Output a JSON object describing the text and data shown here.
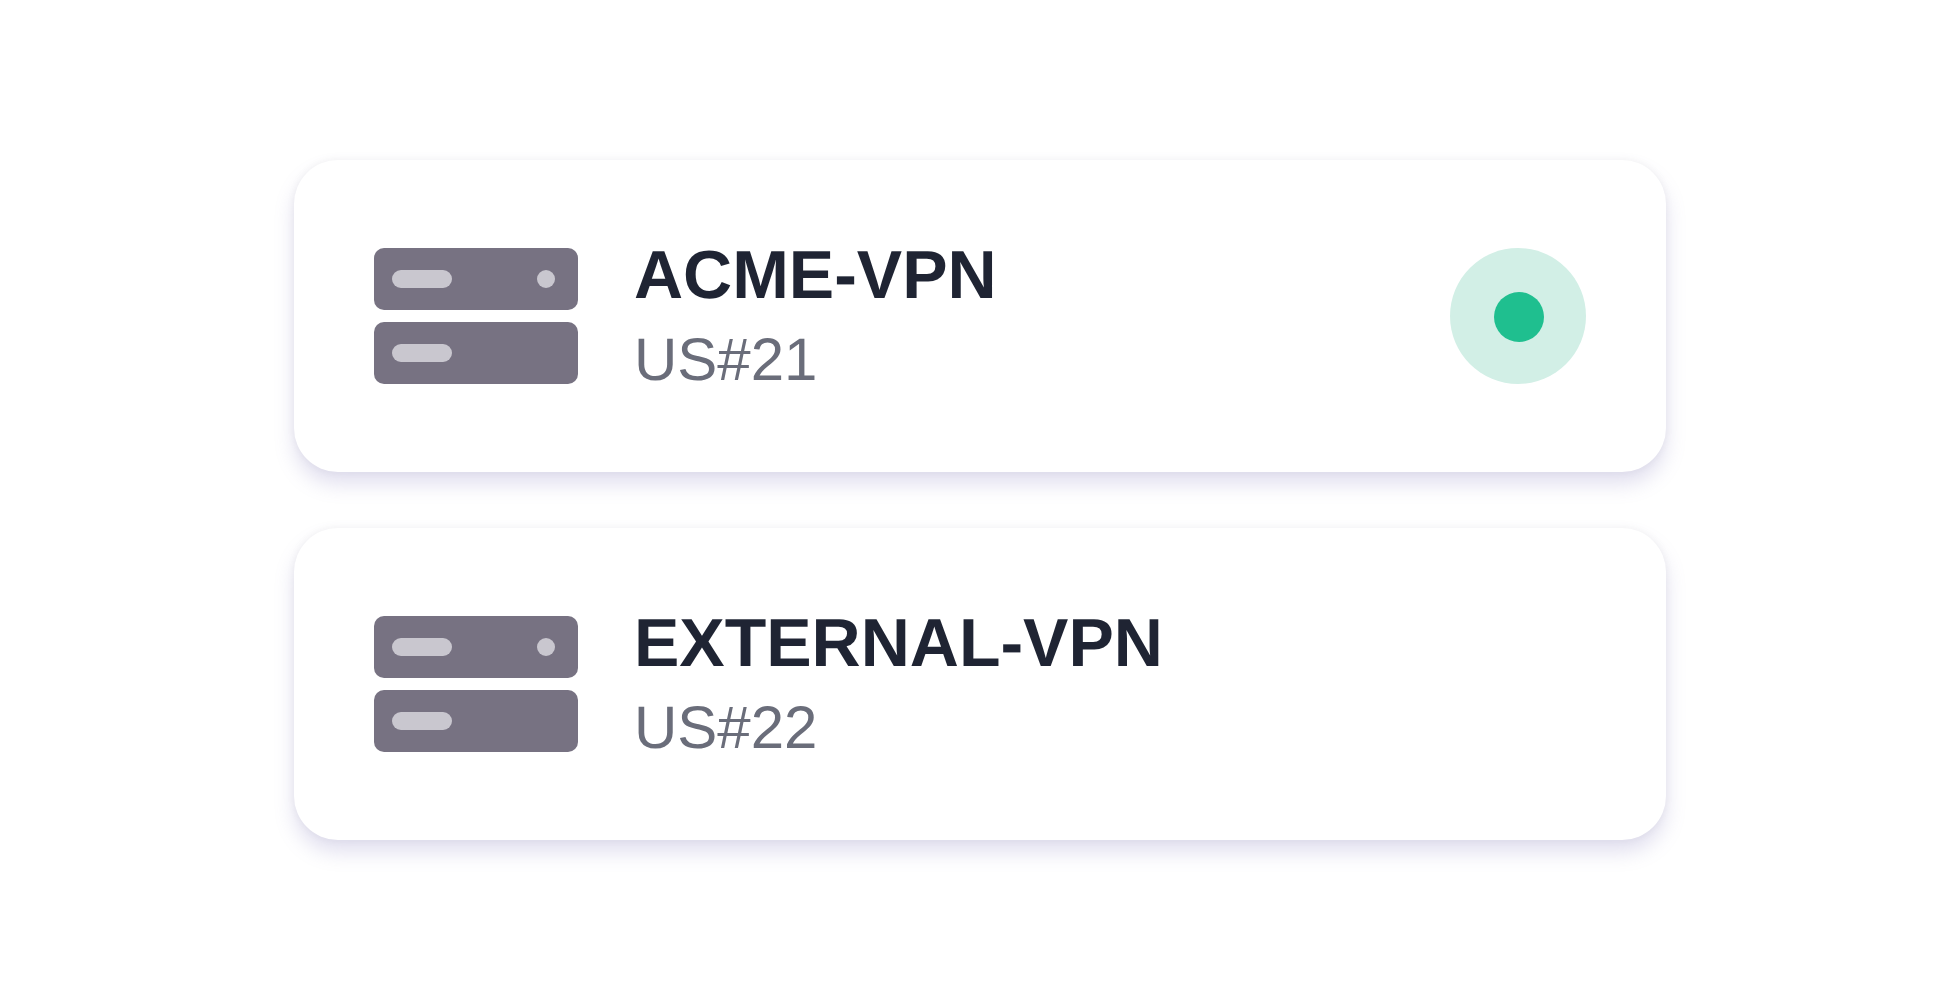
{
  "servers": [
    {
      "name": "ACME-VPN",
      "location": "US#21",
      "connected": true
    },
    {
      "name": "EXTERNAL-VPN",
      "location": "US#22",
      "connected": false
    }
  ]
}
